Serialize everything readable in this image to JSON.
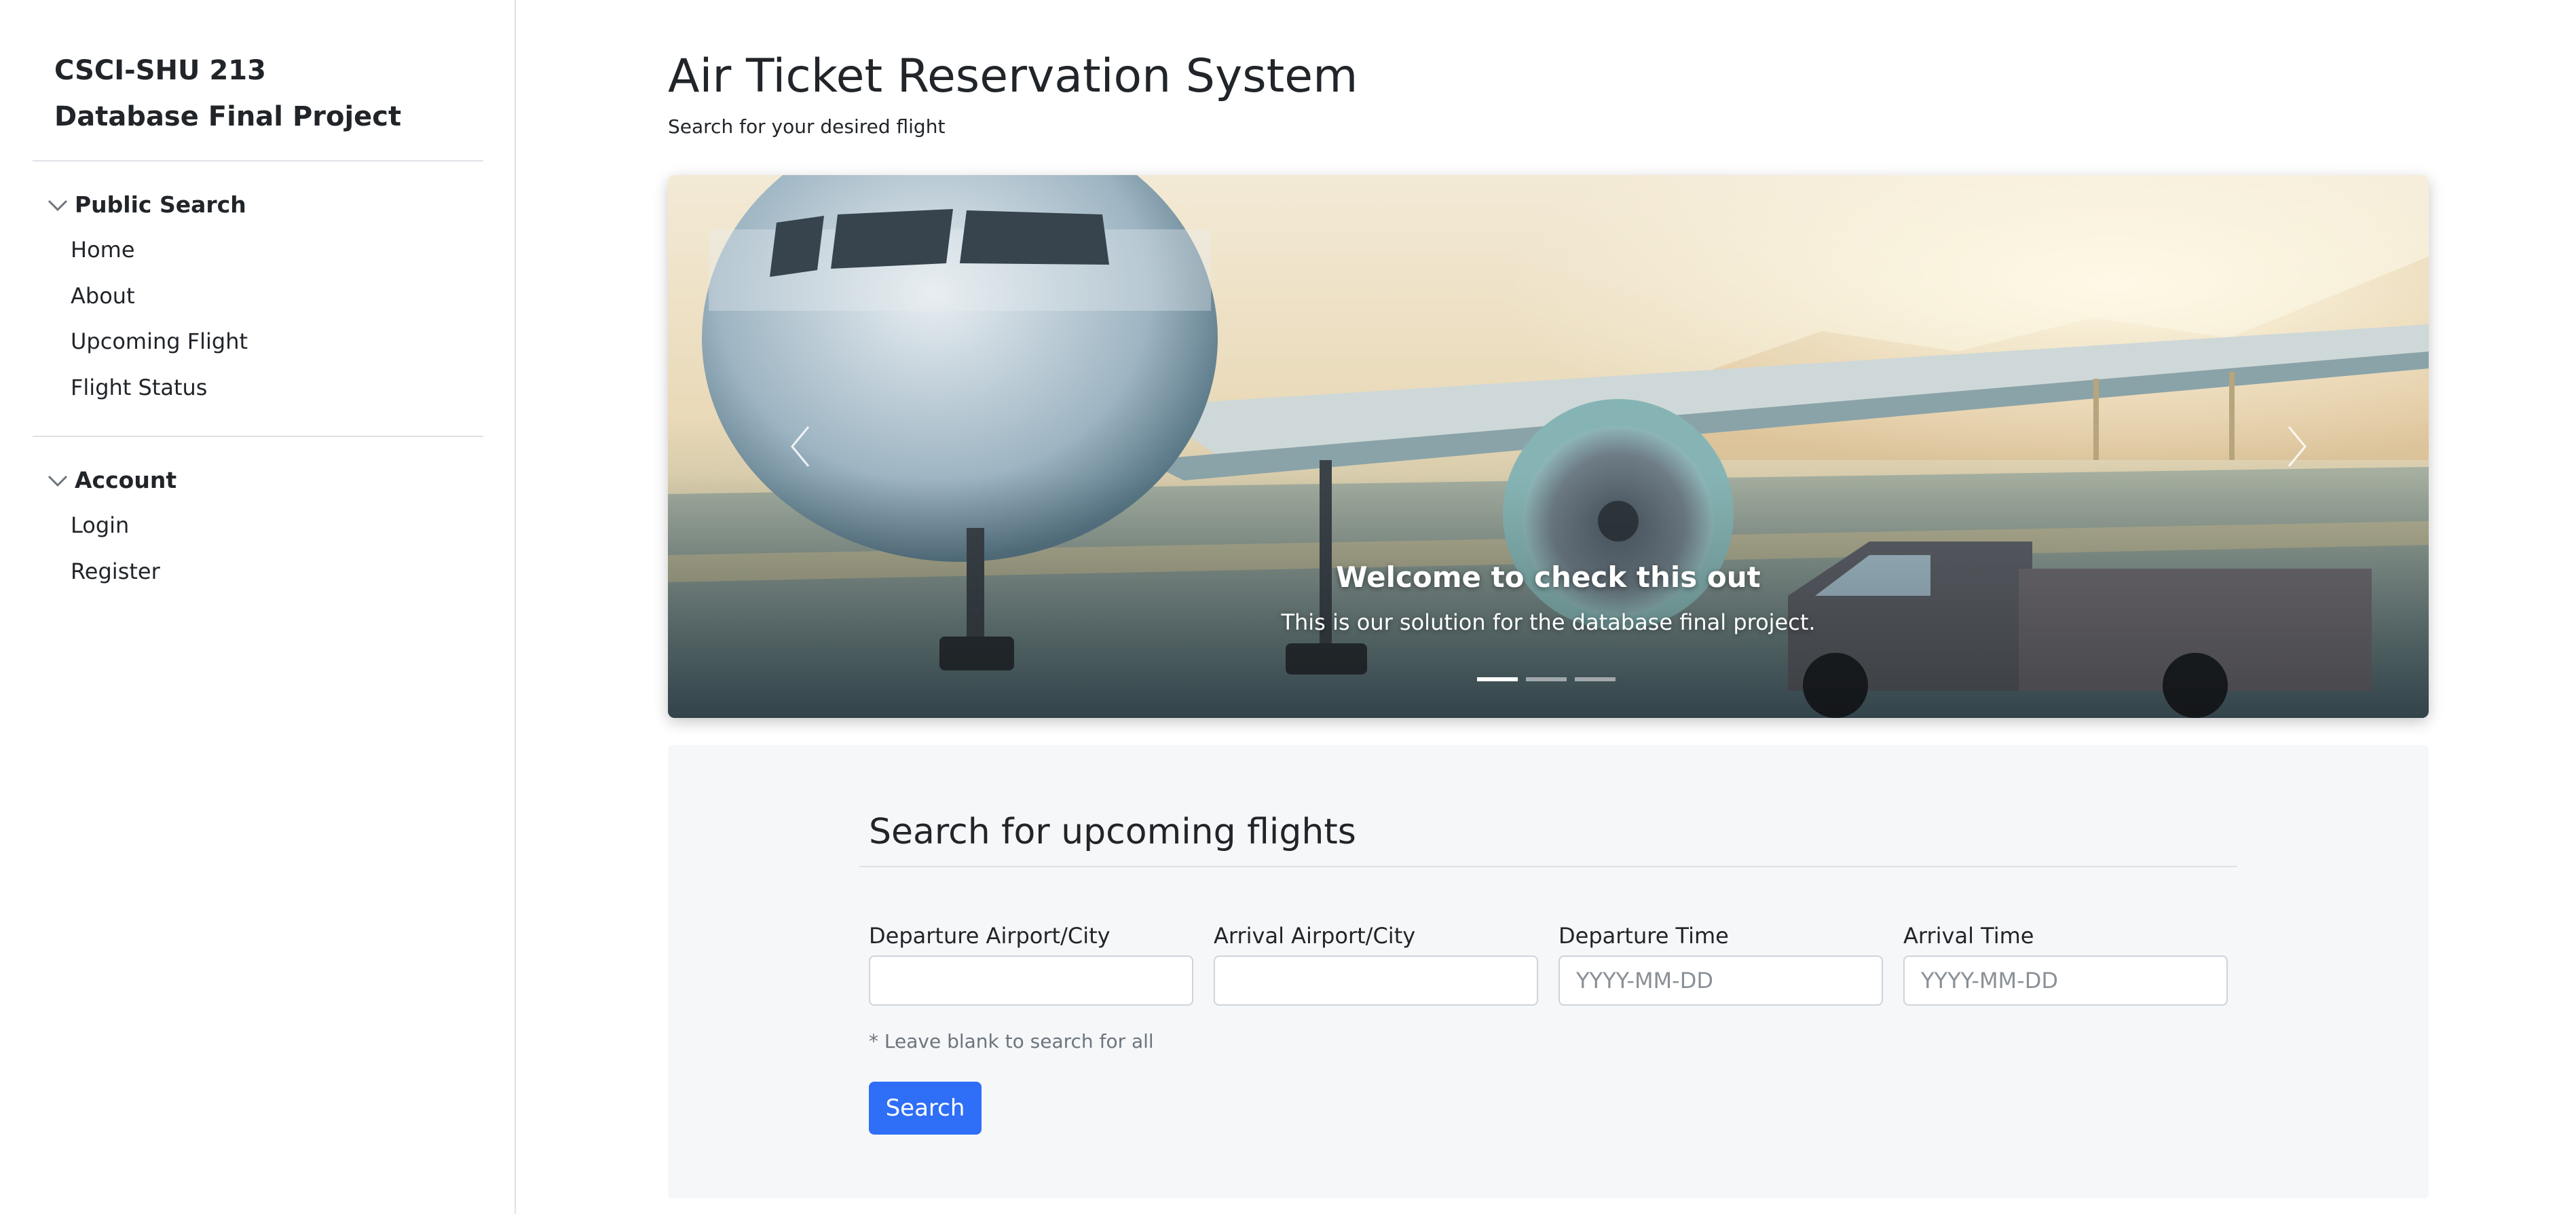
{
  "sidebar": {
    "brand": {
      "line1": "CSCI-SHU 213",
      "line2": "Database Final Project"
    },
    "groups": [
      {
        "title": "Public Search",
        "icon": "chevron-down-icon",
        "items": [
          {
            "label": "Home"
          },
          {
            "label": "About"
          },
          {
            "label": "Upcoming Flight"
          },
          {
            "label": "Flight Status"
          }
        ]
      },
      {
        "title": "Account",
        "icon": "chevron-down-icon",
        "items": [
          {
            "label": "Login"
          },
          {
            "label": "Register"
          }
        ]
      }
    ]
  },
  "header": {
    "title": "Air Ticket Reservation System",
    "subtitle": "Search for your desired flight"
  },
  "carousel": {
    "slide_title": "Welcome to check this out",
    "slide_text": "This is our solution for the database final project.",
    "prev_icon": "chevron-left-icon",
    "next_icon": "chevron-right-icon",
    "indicator_count": 3,
    "active_index": 0
  },
  "search": {
    "heading": "Search for upcoming flights",
    "fields": [
      {
        "label": "Departure Airport/City",
        "value": "",
        "placeholder": ""
      },
      {
        "label": "Arrival Airport/City",
        "value": "",
        "placeholder": ""
      },
      {
        "label": "Departure Time",
        "value": "",
        "placeholder": "YYYY-MM-DD"
      },
      {
        "label": "Arrival Time",
        "value": "",
        "placeholder": "YYYY-MM-DD"
      }
    ],
    "note": "* Leave blank to search for all",
    "button_label": "Search"
  },
  "colors": {
    "primary_button": "#2f6ef7",
    "panel_background": "#f6f7f9",
    "border": "#dee2e6"
  }
}
